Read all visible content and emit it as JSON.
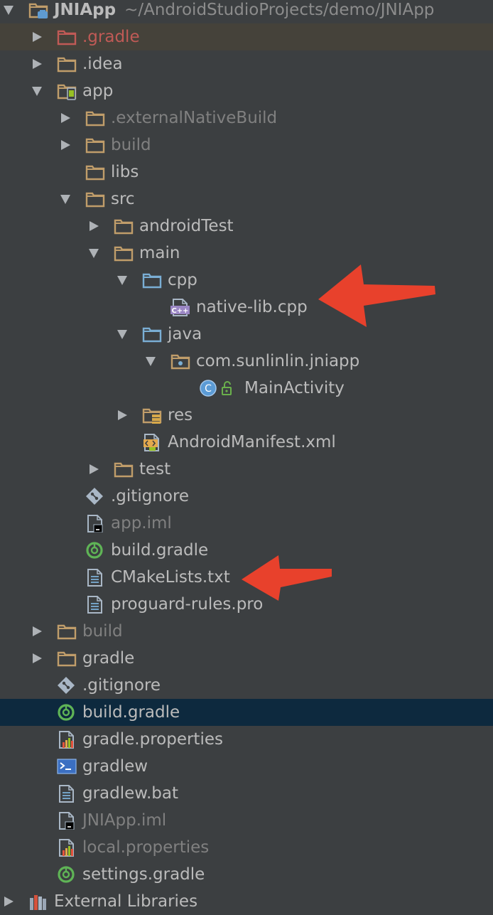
{
  "project": {
    "name": "JNIApp",
    "path": "~/AndroidStudioProjects/demo/JNIApp"
  },
  "tree": [
    {
      "id": "r-jniapp",
      "label": "JNIApp",
      "depth": 0,
      "arrow": "down",
      "icon": "module-folder",
      "style": "bold",
      "extra": "~/AndroidStudioProjects/demo/JNIApp"
    },
    {
      "id": "r-gradle-dir",
      "label": ".gradle",
      "depth": 1,
      "arrow": "right",
      "icon": "folder-red",
      "style": "red",
      "highlight": "gradle"
    },
    {
      "id": "r-idea",
      "label": ".idea",
      "depth": 1,
      "arrow": "right",
      "icon": "folder"
    },
    {
      "id": "r-app",
      "label": "app",
      "depth": 1,
      "arrow": "down",
      "icon": "android-module-folder"
    },
    {
      "id": "r-externalnativebuild",
      "label": ".externalNativeBuild",
      "depth": 2,
      "arrow": "right",
      "icon": "folder",
      "style": "dim"
    },
    {
      "id": "r-app-build",
      "label": "build",
      "depth": 2,
      "arrow": "right",
      "icon": "folder",
      "style": "dim"
    },
    {
      "id": "r-libs",
      "label": "libs",
      "depth": 2,
      "arrow": "none",
      "icon": "folder"
    },
    {
      "id": "r-src",
      "label": "src",
      "depth": 2,
      "arrow": "down",
      "icon": "folder"
    },
    {
      "id": "r-androidtest",
      "label": "androidTest",
      "depth": 3,
      "arrow": "right",
      "icon": "folder"
    },
    {
      "id": "r-main",
      "label": "main",
      "depth": 3,
      "arrow": "down",
      "icon": "folder"
    },
    {
      "id": "r-cpp",
      "label": "cpp",
      "depth": 4,
      "arrow": "down",
      "icon": "folder-blue"
    },
    {
      "id": "r-native-lib",
      "label": "native-lib.cpp",
      "depth": 5,
      "arrow": "none",
      "icon": "cpp-file"
    },
    {
      "id": "r-java",
      "label": "java",
      "depth": 4,
      "arrow": "down",
      "icon": "folder-blue"
    },
    {
      "id": "r-package",
      "label": "com.sunlinlin.jniapp",
      "depth": 5,
      "arrow": "down",
      "icon": "package-folder"
    },
    {
      "id": "r-mainactivity",
      "label": "MainActivity",
      "depth": 6,
      "arrow": "none",
      "icon": "class-file"
    },
    {
      "id": "r-res",
      "label": "res",
      "depth": 4,
      "arrow": "right",
      "icon": "res-folder"
    },
    {
      "id": "r-manifest",
      "label": "AndroidManifest.xml",
      "depth": 4,
      "arrow": "none",
      "icon": "manifest-file"
    },
    {
      "id": "r-test",
      "label": "test",
      "depth": 3,
      "arrow": "right",
      "icon": "folder"
    },
    {
      "id": "r-app-gitignore",
      "label": ".gitignore",
      "depth": 2,
      "arrow": "none",
      "icon": "git-file"
    },
    {
      "id": "r-app-iml",
      "label": "app.iml",
      "depth": 2,
      "arrow": "none",
      "icon": "iml-file",
      "style": "dim"
    },
    {
      "id": "r-app-build-gradle",
      "label": "build.gradle",
      "depth": 2,
      "arrow": "none",
      "icon": "gradle-file"
    },
    {
      "id": "r-cmakelists",
      "label": "CMakeLists.txt",
      "depth": 2,
      "arrow": "none",
      "icon": "text-file"
    },
    {
      "id": "r-proguard",
      "label": "proguard-rules.pro",
      "depth": 2,
      "arrow": "none",
      "icon": "text-file"
    },
    {
      "id": "r-root-build",
      "label": "build",
      "depth": 1,
      "arrow": "right",
      "icon": "folder",
      "style": "dim"
    },
    {
      "id": "r-root-gradle",
      "label": "gradle",
      "depth": 1,
      "arrow": "right",
      "icon": "folder"
    },
    {
      "id": "r-root-gitignore",
      "label": ".gitignore",
      "depth": 1,
      "arrow": "none",
      "icon": "git-file"
    },
    {
      "id": "r-root-build-gradle",
      "label": "build.gradle",
      "depth": 1,
      "arrow": "none",
      "icon": "gradle-file",
      "highlight": "selected"
    },
    {
      "id": "r-gradle-properties",
      "label": "gradle.properties",
      "depth": 1,
      "arrow": "none",
      "icon": "properties-file"
    },
    {
      "id": "r-gradlew",
      "label": "gradlew",
      "depth": 1,
      "arrow": "none",
      "icon": "shell-file"
    },
    {
      "id": "r-gradlew-bat",
      "label": "gradlew.bat",
      "depth": 1,
      "arrow": "none",
      "icon": "text-file"
    },
    {
      "id": "r-jniapp-iml",
      "label": "JNIApp.iml",
      "depth": 1,
      "arrow": "none",
      "icon": "iml-file",
      "style": "dim"
    },
    {
      "id": "r-local-properties",
      "label": "local.properties",
      "depth": 1,
      "arrow": "none",
      "icon": "properties-file",
      "style": "dim"
    },
    {
      "id": "r-settings-gradle",
      "label": "settings.gradle",
      "depth": 1,
      "arrow": "none",
      "icon": "gradle-file"
    },
    {
      "id": "r-external-libraries",
      "label": "External Libraries",
      "depth": 0,
      "arrow": "right",
      "icon": "libraries-icon"
    }
  ],
  "colors": {
    "background": "#3c3f41",
    "text": "#bbbbbb",
    "folder": "#c09d6a",
    "source_folder": "#7aaed4",
    "arrow_annotation": "#e8412c"
  }
}
